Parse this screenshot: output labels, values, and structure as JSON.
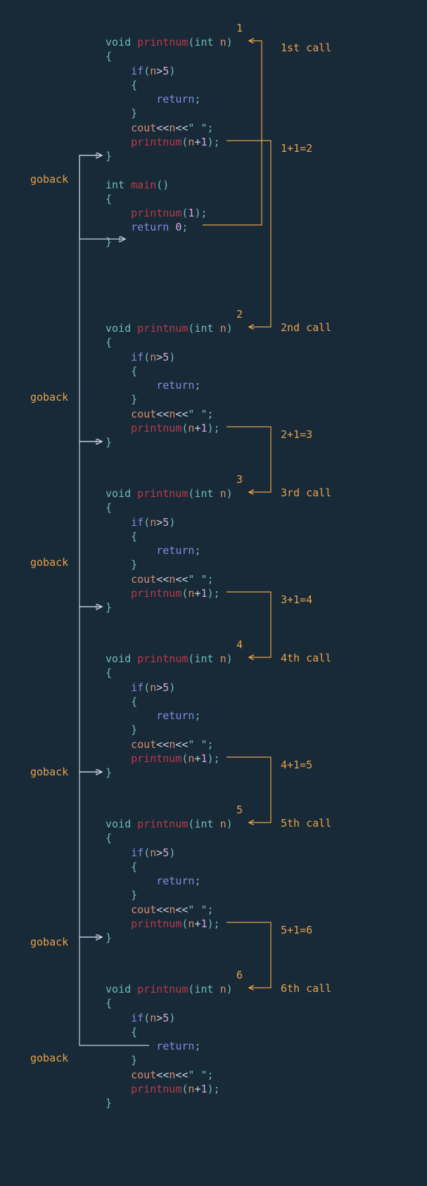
{
  "colors": {
    "bg": "#182937",
    "type": "#6fbdb9",
    "fn": "#ba3a4a",
    "keyword": "#7c8de0",
    "param": "#d68c6f",
    "num": "#d6a9e0",
    "anno": "#e6a34d"
  },
  "blocks": [
    {
      "id": 1,
      "n_label": "1",
      "call_label": "1st call",
      "sum_label": "1+1=2",
      "has_main": true
    },
    {
      "id": 2,
      "n_label": "2",
      "call_label": "2nd call",
      "sum_label": "2+1=3",
      "has_main": false
    },
    {
      "id": 3,
      "n_label": "3",
      "call_label": "3rd call",
      "sum_label": "3+1=4",
      "has_main": false
    },
    {
      "id": 4,
      "n_label": "4",
      "call_label": "4th call",
      "sum_label": "4+1=5",
      "has_main": false
    },
    {
      "id": 5,
      "n_label": "5",
      "call_label": "5th call",
      "sum_label": "5+1=6",
      "has_main": false
    },
    {
      "id": 6,
      "n_label": "6",
      "call_label": "6th call",
      "sum_label": "",
      "has_main": false
    }
  ],
  "goback_label": "goback",
  "code": {
    "fn_decl_void": "void",
    "fn_name": "printnum",
    "fn_param_type": "int",
    "fn_param_name": "n",
    "if_cond": "if(n>5)",
    "return_kw": "return",
    "cout_line_a": "cout<<n<<",
    "cout_line_b": "\" \"",
    "recurse_call": "printnum(n+",
    "one": "1",
    "zero": "0",
    "main_type": "int",
    "main_name": "main",
    "main_call": "printnum(",
    "main_call_arg": "1"
  }
}
